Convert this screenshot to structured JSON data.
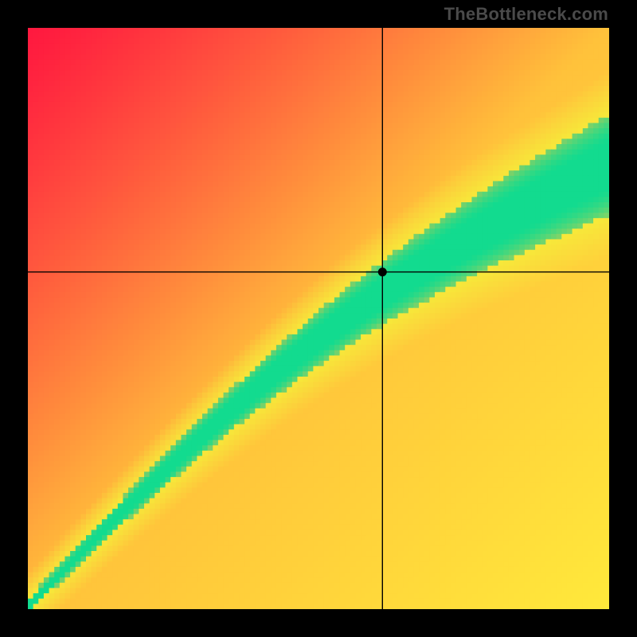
{
  "watermark": "TheBottleneck.com",
  "chart_data": {
    "type": "heatmap",
    "title": "",
    "xlabel": "",
    "ylabel": "",
    "xlim": [
      0,
      1
    ],
    "ylim": [
      0,
      1
    ],
    "crosshair": {
      "x": 0.61,
      "y": 0.58
    },
    "marker": {
      "x": 0.61,
      "y": 0.58,
      "r": 4
    },
    "optimal_band": {
      "description": "Diagonal green band where x and y are balanced",
      "upper": [
        [
          0.01,
          0.98
        ],
        [
          0.35,
          0.72
        ],
        [
          0.7,
          0.4
        ],
        [
          1.0,
          0.18
        ]
      ],
      "lower": [
        [
          0.01,
          0.995
        ],
        [
          0.35,
          0.8
        ],
        [
          0.7,
          0.52
        ],
        [
          1.0,
          0.34
        ]
      ]
    },
    "palette": {
      "low": "#ff183f",
      "mid": "#ffc23b",
      "high": "#ffe93b",
      "optimal": "#12db8f"
    }
  }
}
